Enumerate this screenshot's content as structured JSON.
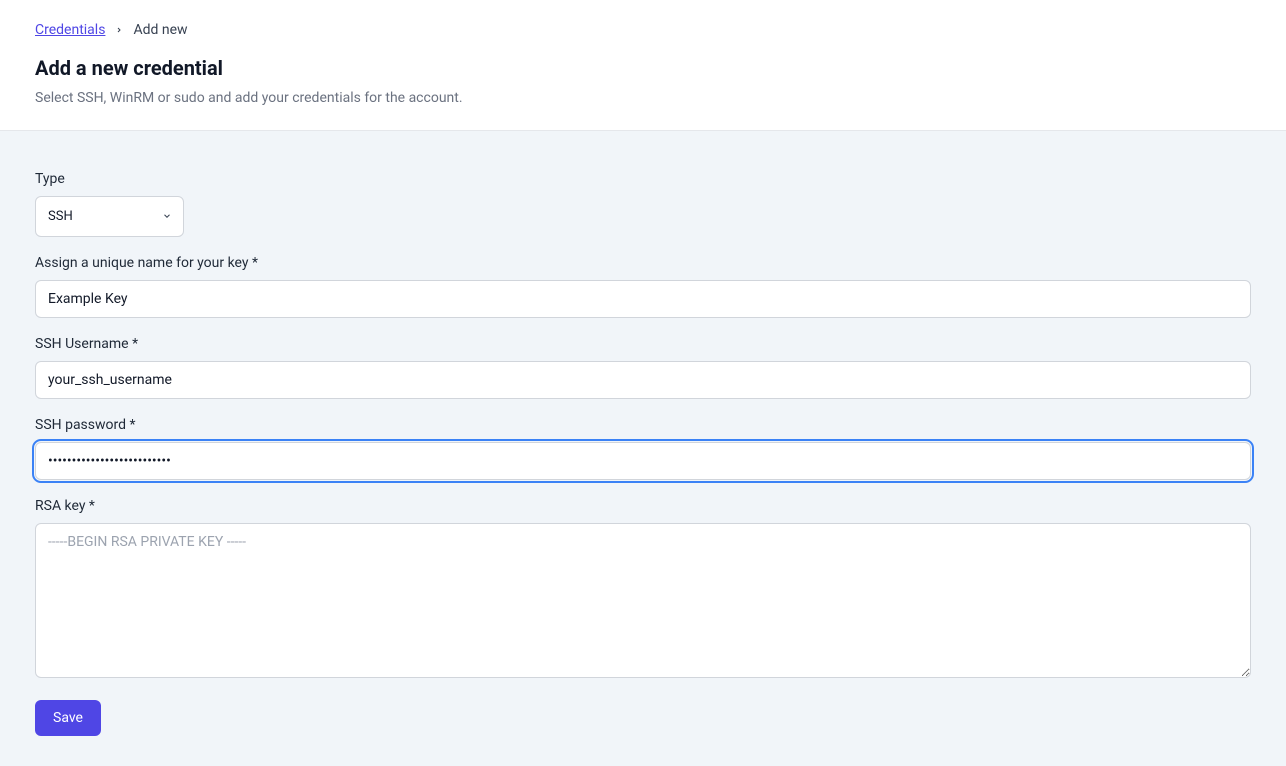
{
  "breadcrumb": {
    "root": "Credentials",
    "current": "Add new"
  },
  "header": {
    "title": "Add a new credential",
    "subtitle": "Select SSH, WinRM or sudo and add your credentials for the account."
  },
  "form": {
    "type": {
      "label": "Type",
      "value": "SSH"
    },
    "keyName": {
      "label": "Assign a unique name for your key *",
      "value": "Example Key"
    },
    "sshUsername": {
      "label": "SSH Username *",
      "value": "your_ssh_username"
    },
    "sshPassword": {
      "label": "SSH password *",
      "value": "••••••••••••••••••••••••••"
    },
    "rsaKey": {
      "label": "RSA key *",
      "placeholder": "-----BEGIN RSA PRIVATE KEY -----",
      "value": ""
    },
    "saveButton": "Save"
  }
}
